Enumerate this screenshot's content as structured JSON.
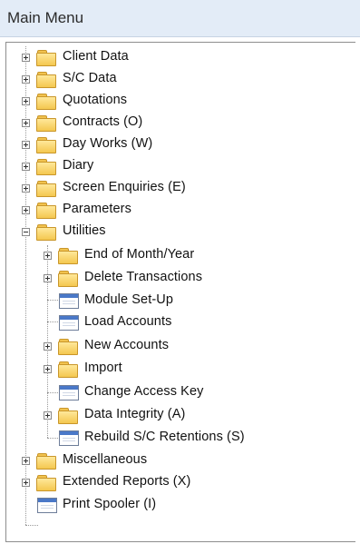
{
  "header": {
    "title": "Main Menu"
  },
  "tree": {
    "items": [
      {
        "label": "Client Data"
      },
      {
        "label": "S/C Data"
      },
      {
        "label": "Quotations"
      },
      {
        "label": "Contracts   (O)"
      },
      {
        "label": "Day Works   (W)"
      },
      {
        "label": "Diary"
      },
      {
        "label": "Screen Enquiries   (E)"
      },
      {
        "label": "Parameters"
      },
      {
        "label": "Utilities"
      },
      {
        "label": "End of Month/Year"
      },
      {
        "label": "Delete Transactions"
      },
      {
        "label": "Module Set-Up"
      },
      {
        "label": "Load Accounts"
      },
      {
        "label": "New Accounts"
      },
      {
        "label": "Import"
      },
      {
        "label": "Change Access Key"
      },
      {
        "label": "Data Integrity   (A)"
      },
      {
        "label": "Rebuild S/C Retentions   (S)"
      },
      {
        "label": "Miscellaneous"
      },
      {
        "label": "Extended Reports   (X)"
      },
      {
        "label": "Print Spooler   (I)"
      }
    ]
  }
}
